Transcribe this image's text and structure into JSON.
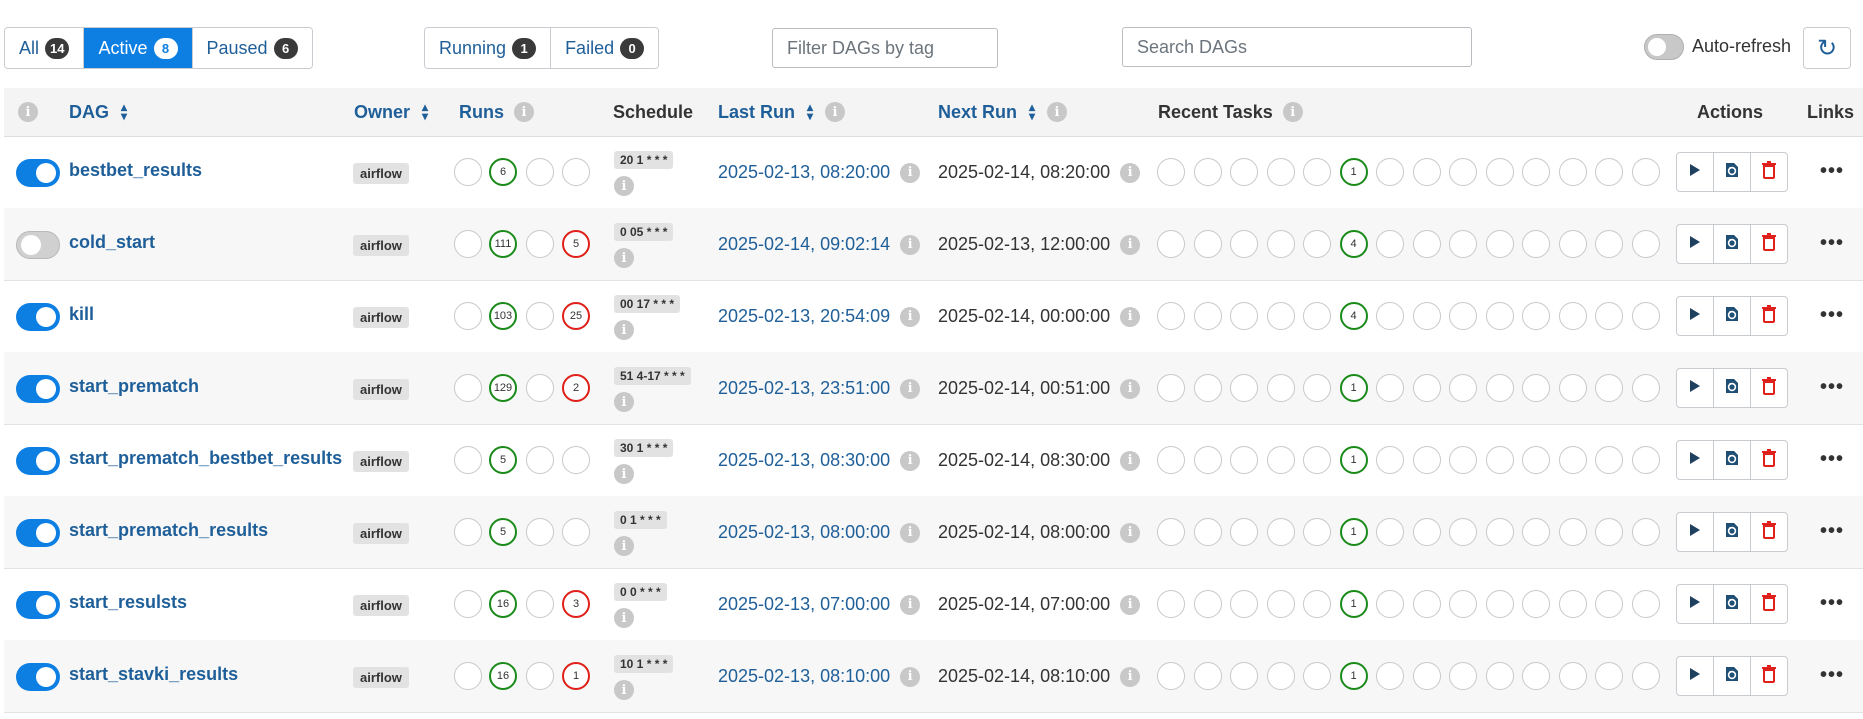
{
  "filters": {
    "status": [
      {
        "label": "All",
        "count": "14",
        "active": false
      },
      {
        "label": "Active",
        "count": "8",
        "active": true
      },
      {
        "label": "Paused",
        "count": "6",
        "active": false
      }
    ],
    "state": [
      {
        "label": "Running",
        "count": "1"
      },
      {
        "label": "Failed",
        "count": "0"
      }
    ],
    "tag_placeholder": "Filter DAGs by tag",
    "search_placeholder": "Search DAGs",
    "auto_refresh_label": "Auto-refresh"
  },
  "columns": {
    "dag": "DAG",
    "owner": "Owner",
    "runs": "Runs",
    "schedule": "Schedule",
    "last_run": "Last Run",
    "next_run": "Next Run",
    "recent_tasks": "Recent Tasks",
    "actions": "Actions",
    "links": "Links"
  },
  "colors": {
    "accent": "#0d7fe3",
    "link": "#1f5f99",
    "success": "#1a8a1a",
    "failed": "#e0201a"
  },
  "dags": [
    {
      "name": "bestbet_results",
      "active": true,
      "owner": "airflow",
      "runs": {
        "success": "6",
        "failed": ""
      },
      "schedule": "20 1 * * *",
      "last_run": "2025-02-13, 08:20:00",
      "next_run": "2025-02-14, 08:20:00",
      "recent_task_success": "1"
    },
    {
      "name": "cold_start",
      "active": false,
      "owner": "airflow",
      "runs": {
        "success": "111",
        "failed": "5"
      },
      "schedule": "0 05 * * *",
      "last_run": "2025-02-14, 09:02:14",
      "next_run": "2025-02-13, 12:00:00",
      "recent_task_success": "4"
    },
    {
      "name": "kill",
      "active": true,
      "owner": "airflow",
      "runs": {
        "success": "103",
        "failed": "25"
      },
      "schedule": "00 17 * * *",
      "last_run": "2025-02-13, 20:54:09",
      "next_run": "2025-02-14, 00:00:00",
      "recent_task_success": "4"
    },
    {
      "name": "start_prematch",
      "active": true,
      "owner": "airflow",
      "runs": {
        "success": "129",
        "failed": "2"
      },
      "schedule": "51 4-17 * * *",
      "last_run": "2025-02-13, 23:51:00",
      "next_run": "2025-02-14, 00:51:00",
      "recent_task_success": "1"
    },
    {
      "name": "start_prematch_bestbet_results",
      "active": true,
      "owner": "airflow",
      "runs": {
        "success": "5",
        "failed": ""
      },
      "schedule": "30 1 * * *",
      "last_run": "2025-02-13, 08:30:00",
      "next_run": "2025-02-14, 08:30:00",
      "recent_task_success": "1"
    },
    {
      "name": "start_prematch_results",
      "active": true,
      "owner": "airflow",
      "runs": {
        "success": "5",
        "failed": ""
      },
      "schedule": "0 1 * * *",
      "last_run": "2025-02-13, 08:00:00",
      "next_run": "2025-02-14, 08:00:00",
      "recent_task_success": "1"
    },
    {
      "name": "start_resulsts",
      "active": true,
      "owner": "airflow",
      "runs": {
        "success": "16",
        "failed": "3"
      },
      "schedule": "0 0 * * *",
      "last_run": "2025-02-13, 07:00:00",
      "next_run": "2025-02-14, 07:00:00",
      "recent_task_success": "1"
    },
    {
      "name": "start_stavki_results",
      "active": true,
      "owner": "airflow",
      "runs": {
        "success": "16",
        "failed": "1"
      },
      "schedule": "10 1 * * *",
      "last_run": "2025-02-13, 08:10:00",
      "next_run": "2025-02-14, 08:10:00",
      "recent_task_success": "1"
    }
  ],
  "icons": {
    "play": "play-icon",
    "refresh": "refresh-icon",
    "delete": "trash-icon",
    "more": "ellipsis-icon",
    "info": "info-icon",
    "sort": "sort-icon"
  }
}
